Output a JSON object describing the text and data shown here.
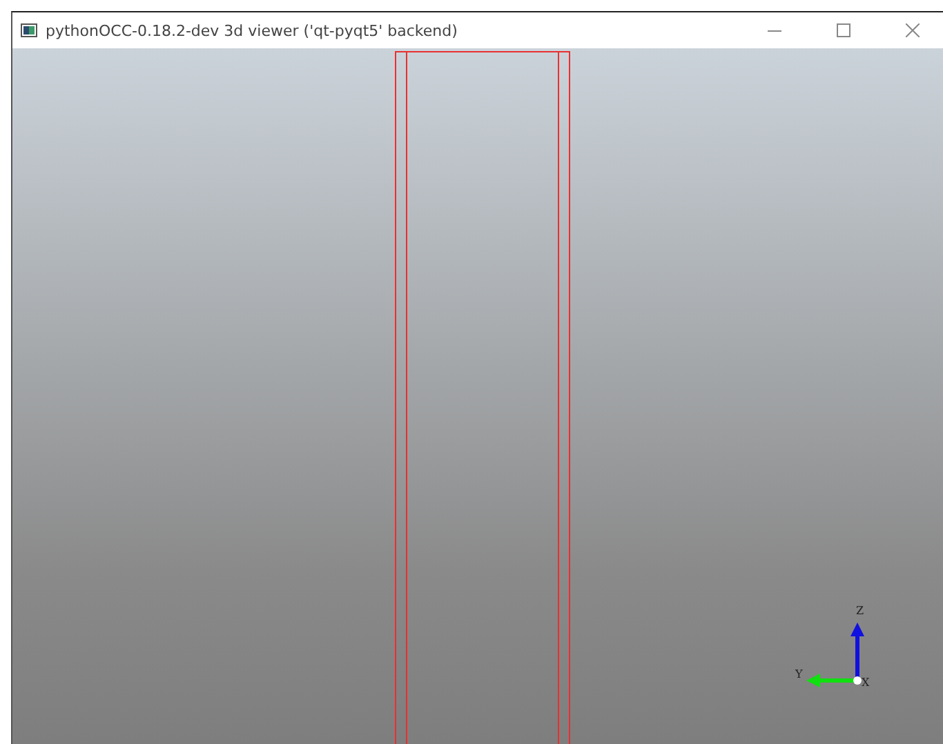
{
  "window": {
    "title": "pythonOCC-0.18.2-dev 3d viewer ('qt-pyqt5' backend)"
  },
  "viewer": {
    "axes": [
      {
        "label": "Z",
        "kind": "z"
      },
      {
        "label": "Y",
        "kind": "y"
      },
      {
        "label": "X",
        "kind": "x"
      }
    ]
  }
}
